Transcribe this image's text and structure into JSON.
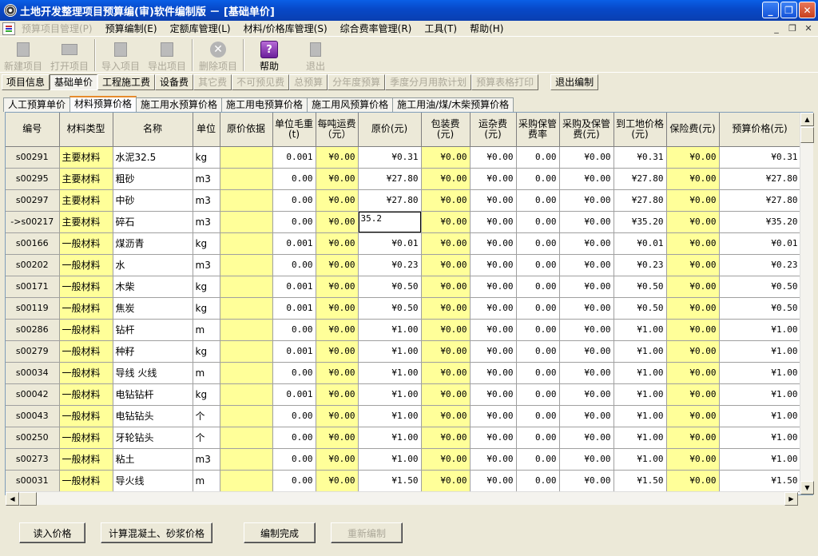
{
  "window": {
    "title": "土地开发整理项目预算编(审)软件编制版 － [基础单价]"
  },
  "menu": [
    {
      "label": "预算项目管理(P)",
      "enabled": false
    },
    {
      "label": "预算编制(E)",
      "enabled": true
    },
    {
      "label": "定额库管理(L)",
      "enabled": true
    },
    {
      "label": "材料/价格库管理(S)",
      "enabled": true
    },
    {
      "label": "综合费率管理(R)",
      "enabled": true
    },
    {
      "label": "工具(T)",
      "enabled": true
    },
    {
      "label": "帮助(H)",
      "enabled": true
    }
  ],
  "toolbar": {
    "new_project": "新建项目",
    "open_project": "打开项目",
    "import_project": "导入项目",
    "export_project": "导出项目",
    "delete_project": "删除项目",
    "help": "帮助",
    "exit": "退出"
  },
  "modebar": [
    {
      "label": "项目信息",
      "enabled": true,
      "active": false
    },
    {
      "label": "基础单价",
      "enabled": true,
      "active": true
    },
    {
      "label": "工程施工费",
      "enabled": true,
      "active": false
    },
    {
      "label": "设备费",
      "enabled": true,
      "active": false
    },
    {
      "label": "其它费",
      "enabled": false,
      "active": false
    },
    {
      "label": "不可预见费",
      "enabled": false,
      "active": false
    },
    {
      "label": "总预算",
      "enabled": false,
      "active": false
    },
    {
      "label": "分年度预算",
      "enabled": false,
      "active": false
    },
    {
      "label": "季度分月用款计划",
      "enabled": false,
      "active": false
    },
    {
      "label": "预算表格打印",
      "enabled": false,
      "active": false
    }
  ],
  "exit_edit": "退出编制",
  "tabs": [
    {
      "label": "人工预算单价",
      "active": false
    },
    {
      "label": "材料预算价格",
      "active": true
    },
    {
      "label": "施工用水预算价格",
      "active": false
    },
    {
      "label": "施工用电预算价格",
      "active": false
    },
    {
      "label": "施工用风预算价格",
      "active": false
    },
    {
      "label": "施工用油/煤/木柴预算价格",
      "active": false
    }
  ],
  "table": {
    "headers": [
      "编号",
      "材料类型",
      "名称",
      "单位",
      "原价依据",
      "单位毛重(t)",
      "每吨运费（元）",
      "原价(元)",
      "包装费(元)",
      "运杂费(元)",
      "采购保管费率",
      "采购及保管费(元)",
      "到工地价格(元)",
      "保险费(元)",
      "预算价格(元)"
    ],
    "editing_value": "35.2",
    "rows": [
      [
        "s00291",
        "主要材料",
        "水泥32.5",
        "kg",
        "",
        "0.001",
        "¥0.00",
        "¥0.31",
        "¥0.00",
        "¥0.00",
        "0.00",
        "¥0.00",
        "¥0.31",
        "¥0.00",
        "¥0.31"
      ],
      [
        "s00295",
        "主要材料",
        "粗砂",
        "m3",
        "",
        "0.00",
        "¥0.00",
        "¥27.80",
        "¥0.00",
        "¥0.00",
        "0.00",
        "¥0.00",
        "¥27.80",
        "¥0.00",
        "¥27.80"
      ],
      [
        "s00297",
        "主要材料",
        "中砂",
        "m3",
        "",
        "0.00",
        "¥0.00",
        "¥27.80",
        "¥0.00",
        "¥0.00",
        "0.00",
        "¥0.00",
        "¥27.80",
        "¥0.00",
        "¥27.80"
      ],
      [
        "->s00217",
        "主要材料",
        "碎石",
        "m3",
        "",
        "0.00",
        "¥0.00",
        "",
        "¥0.00",
        "¥0.00",
        "0.00",
        "¥0.00",
        "¥35.20",
        "¥0.00",
        "¥35.20"
      ],
      [
        "s00166",
        "一般材料",
        "煤沥青",
        "kg",
        "",
        "0.001",
        "¥0.00",
        "¥0.01",
        "¥0.00",
        "¥0.00",
        "0.00",
        "¥0.00",
        "¥0.01",
        "¥0.00",
        "¥0.01"
      ],
      [
        "s00202",
        "一般材料",
        "水",
        "m3",
        "",
        "0.00",
        "¥0.00",
        "¥0.23",
        "¥0.00",
        "¥0.00",
        "0.00",
        "¥0.00",
        "¥0.23",
        "¥0.00",
        "¥0.23"
      ],
      [
        "s00171",
        "一般材料",
        "木柴",
        "kg",
        "",
        "0.001",
        "¥0.00",
        "¥0.50",
        "¥0.00",
        "¥0.00",
        "0.00",
        "¥0.00",
        "¥0.50",
        "¥0.00",
        "¥0.50"
      ],
      [
        "s00119",
        "一般材料",
        "焦炭",
        "kg",
        "",
        "0.001",
        "¥0.00",
        "¥0.50",
        "¥0.00",
        "¥0.00",
        "0.00",
        "¥0.00",
        "¥0.50",
        "¥0.00",
        "¥0.50"
      ],
      [
        "s00286",
        "一般材料",
        "钻杆",
        "m",
        "",
        "0.00",
        "¥0.00",
        "¥1.00",
        "¥0.00",
        "¥0.00",
        "0.00",
        "¥0.00",
        "¥1.00",
        "¥0.00",
        "¥1.00"
      ],
      [
        "s00279",
        "一般材料",
        "种籽",
        "kg",
        "",
        "0.001",
        "¥0.00",
        "¥1.00",
        "¥0.00",
        "¥0.00",
        "0.00",
        "¥0.00",
        "¥1.00",
        "¥0.00",
        "¥1.00"
      ],
      [
        "s00034",
        "一般材料",
        "导线 火线",
        "m",
        "",
        "0.00",
        "¥0.00",
        "¥1.00",
        "¥0.00",
        "¥0.00",
        "0.00",
        "¥0.00",
        "¥1.00",
        "¥0.00",
        "¥1.00"
      ],
      [
        "s00042",
        "一般材料",
        "电钻钻杆",
        "kg",
        "",
        "0.001",
        "¥0.00",
        "¥1.00",
        "¥0.00",
        "¥0.00",
        "0.00",
        "¥0.00",
        "¥1.00",
        "¥0.00",
        "¥1.00"
      ],
      [
        "s00043",
        "一般材料",
        "电钻钻头",
        "个",
        "",
        "0.00",
        "¥0.00",
        "¥1.00",
        "¥0.00",
        "¥0.00",
        "0.00",
        "¥0.00",
        "¥1.00",
        "¥0.00",
        "¥1.00"
      ],
      [
        "s00250",
        "一般材料",
        "牙轮钻头",
        "个",
        "",
        "0.00",
        "¥0.00",
        "¥1.00",
        "¥0.00",
        "¥0.00",
        "0.00",
        "¥0.00",
        "¥1.00",
        "¥0.00",
        "¥1.00"
      ],
      [
        "s00273",
        "一般材料",
        "粘土",
        "m3",
        "",
        "0.00",
        "¥0.00",
        "¥1.00",
        "¥0.00",
        "¥0.00",
        "0.00",
        "¥0.00",
        "¥1.00",
        "¥0.00",
        "¥1.00"
      ],
      [
        "s00031",
        "一般材料",
        "导火线",
        "m",
        "",
        "0.00",
        "¥0.00",
        "¥1.50",
        "¥0.00",
        "¥0.00",
        "0.00",
        "¥0.00",
        "¥1.50",
        "¥0.00",
        "¥1.50"
      ]
    ]
  },
  "bottom": {
    "read_price": "读入价格",
    "calc_concrete": "计算混凝土、砂浆价格",
    "finish_edit": "编制完成",
    "re_edit": "重新编制"
  }
}
